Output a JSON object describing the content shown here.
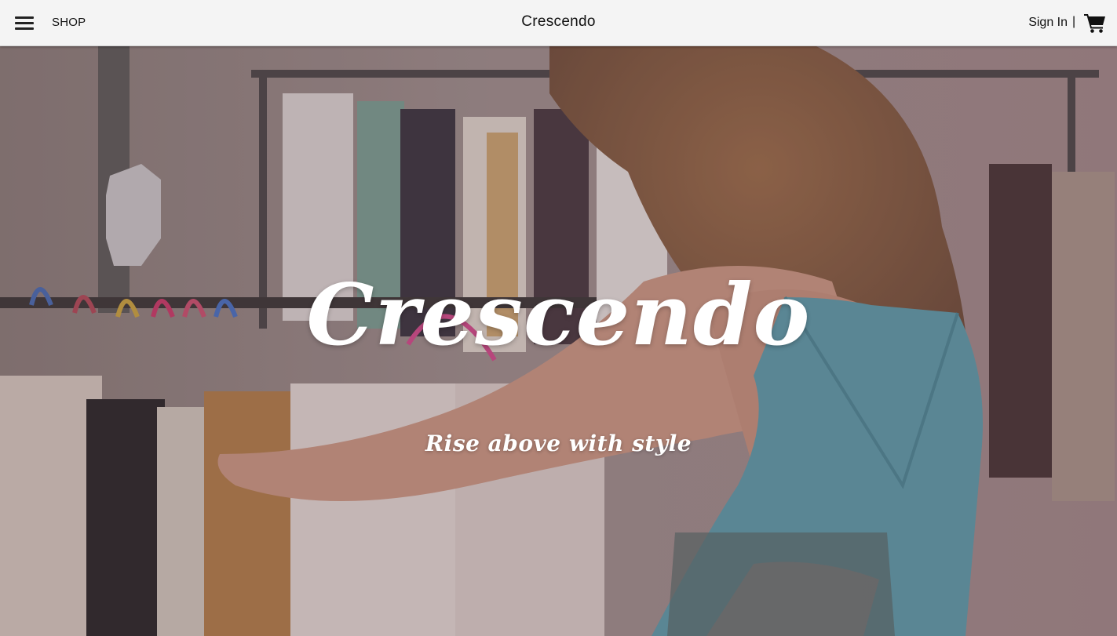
{
  "nav": {
    "menu_icon": "hamburger-menu-icon",
    "shop_label": "SHOP",
    "brand": "Crescendo",
    "signin_label": "Sign In",
    "divider": "|",
    "cart_icon": "shopping-cart-icon"
  },
  "hero": {
    "title": "Crescendo",
    "tagline": "Rise above with style",
    "background_description_icon": "clothing-rack-photo"
  },
  "colors": {
    "nav_background": "#f4f4f4",
    "nav_text": "#111111",
    "hero_text": "#ffffff"
  }
}
